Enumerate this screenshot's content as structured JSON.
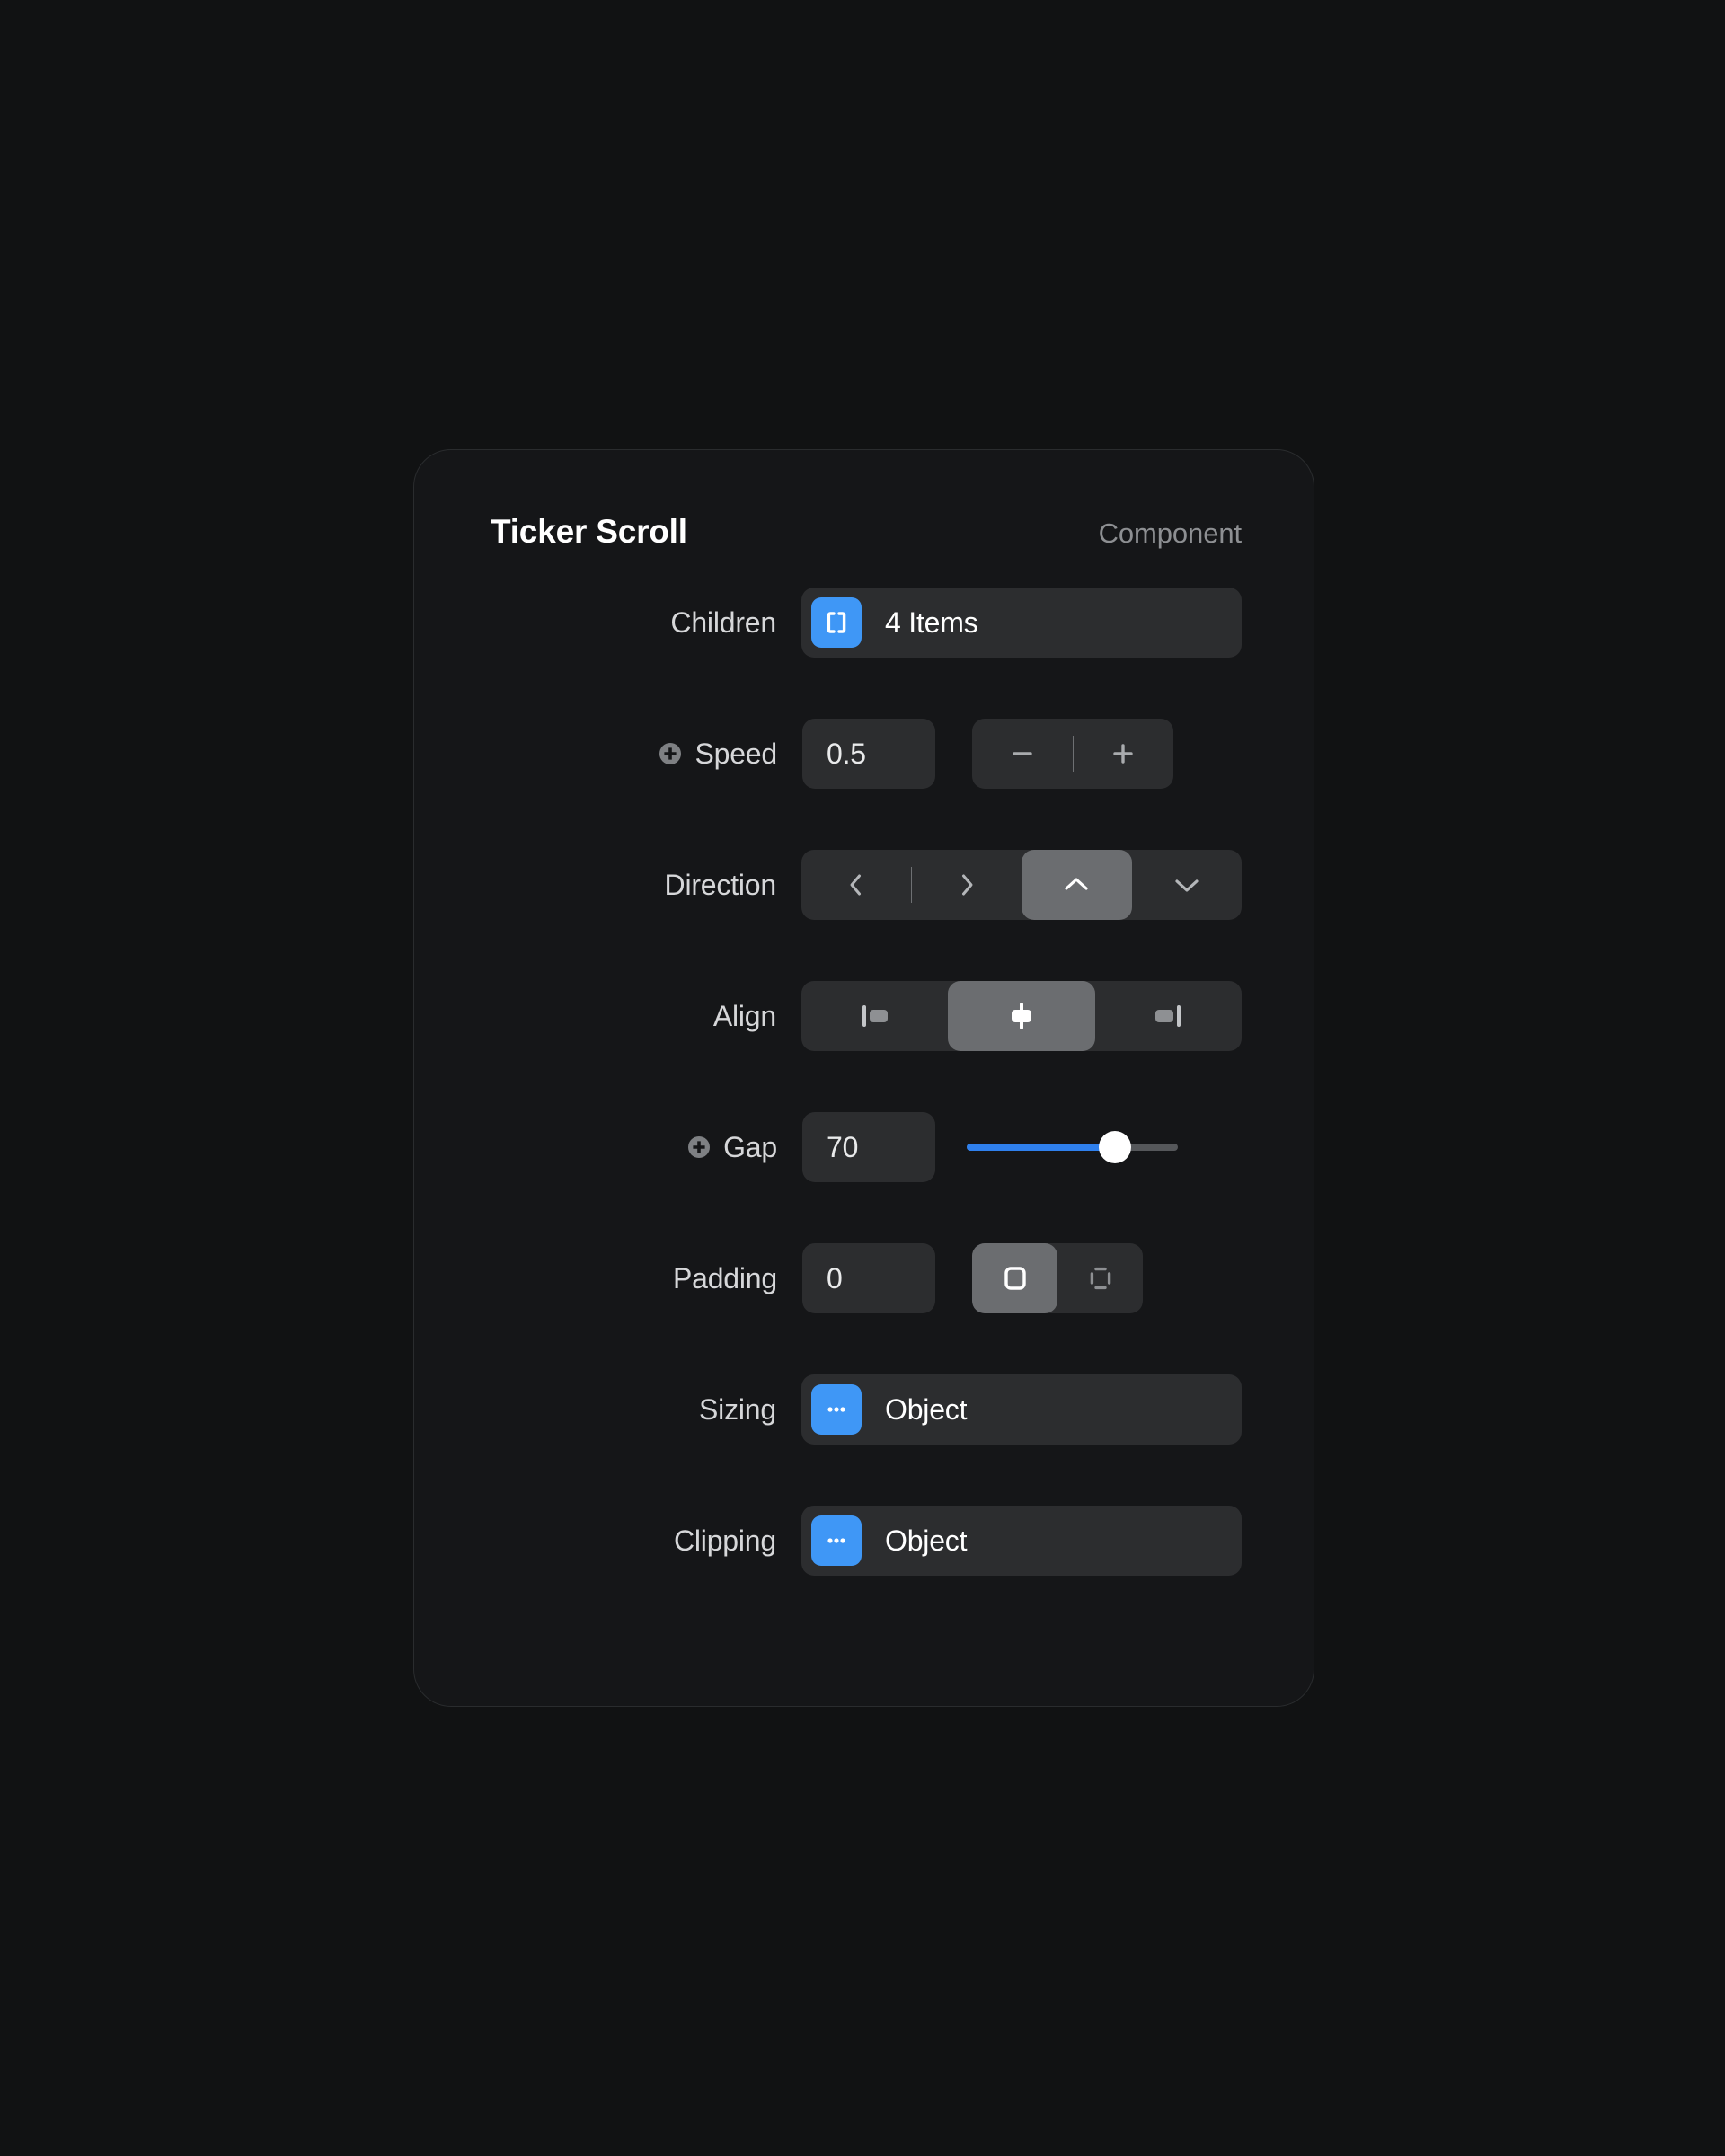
{
  "panel": {
    "title": "Ticker Scroll",
    "kind": "Component"
  },
  "accent_color": "#3f97f6",
  "slider_color": "#2f80ed",
  "rows": {
    "children": {
      "label": "Children",
      "icon": "brackets-icon",
      "value": "4 Items"
    },
    "speed": {
      "label": "Speed",
      "prefix_icon": "plus-circle-icon",
      "value": "0.5",
      "decrement_icon": "minus-icon",
      "increment_icon": "plus-icon"
    },
    "direction": {
      "label": "Direction",
      "options": [
        {
          "name": "direction-left",
          "icon": "chevron-left-icon",
          "selected": false
        },
        {
          "name": "direction-right",
          "icon": "chevron-right-icon",
          "selected": false
        },
        {
          "name": "direction-up",
          "icon": "chevron-up-icon",
          "selected": true
        },
        {
          "name": "direction-down",
          "icon": "chevron-down-icon",
          "selected": false
        }
      ],
      "selected": "direction-up"
    },
    "align": {
      "label": "Align",
      "options": [
        {
          "name": "align-start",
          "icon": "align-start-icon",
          "selected": false
        },
        {
          "name": "align-center",
          "icon": "align-center-icon",
          "selected": true
        },
        {
          "name": "align-end",
          "icon": "align-end-icon",
          "selected": false
        }
      ],
      "selected": "align-center"
    },
    "gap": {
      "label": "Gap",
      "prefix_icon": "plus-circle-icon",
      "value": "70",
      "slider_percent": 70
    },
    "padding": {
      "label": "Padding",
      "value": "0",
      "options": [
        {
          "name": "padding-uniform",
          "icon": "square-solid-icon",
          "selected": true
        },
        {
          "name": "padding-individual",
          "icon": "square-dashed-icon",
          "selected": false
        }
      ],
      "selected": "padding-uniform"
    },
    "sizing": {
      "label": "Sizing",
      "icon": "ellipsis-icon",
      "value": "Object"
    },
    "clipping": {
      "label": "Clipping",
      "icon": "ellipsis-icon",
      "value": "Object"
    }
  }
}
